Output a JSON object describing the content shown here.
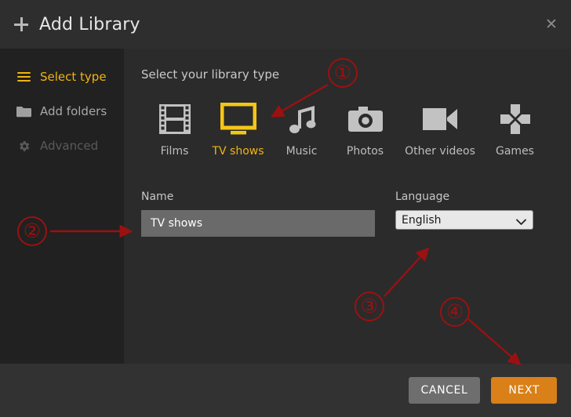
{
  "window": {
    "title": "Add Library",
    "plus_icon": "plus-icon",
    "close_icon": "close-icon"
  },
  "sidebar": {
    "items": [
      {
        "label": "Select type",
        "icon": "hamburger-icon",
        "state": "active"
      },
      {
        "label": "Add folders",
        "icon": "folder-icon",
        "state": "normal"
      },
      {
        "label": "Advanced",
        "icon": "gear-icon",
        "state": "disabled"
      }
    ]
  },
  "main": {
    "heading": "Select your library type",
    "library_types": [
      {
        "label": "Films",
        "icon": "film-strip-icon",
        "selected": false
      },
      {
        "label": "TV shows",
        "icon": "television-icon",
        "selected": true
      },
      {
        "label": "Music",
        "icon": "music-note-icon",
        "selected": false
      },
      {
        "label": "Photos",
        "icon": "camera-icon",
        "selected": false
      },
      {
        "label": "Other videos",
        "icon": "video-camera-icon",
        "selected": false
      },
      {
        "label": "Games",
        "icon": "gamepad-dpad-icon",
        "selected": false
      }
    ],
    "name_field": {
      "label": "Name",
      "value": "TV shows",
      "placeholder": ""
    },
    "language_field": {
      "label": "Language",
      "value": "English",
      "options": [
        "English"
      ],
      "chevron_icon": "chevron-down-icon"
    }
  },
  "footer": {
    "cancel_label": "CANCEL",
    "next_label": "NEXT"
  },
  "annotations": [
    {
      "number": "①",
      "target": "tv-shows-type-icon"
    },
    {
      "number": "②",
      "target": "name-input"
    },
    {
      "number": "③",
      "target": "language-select"
    },
    {
      "number": "④",
      "target": "next-button"
    }
  ],
  "colors": {
    "accent": "#f0b410",
    "primary_button": "#d98018",
    "annotation": "#9b1111",
    "window_bg": "#2b2b2b",
    "sidebar_bg": "#212121",
    "footer_bg": "#323232"
  }
}
